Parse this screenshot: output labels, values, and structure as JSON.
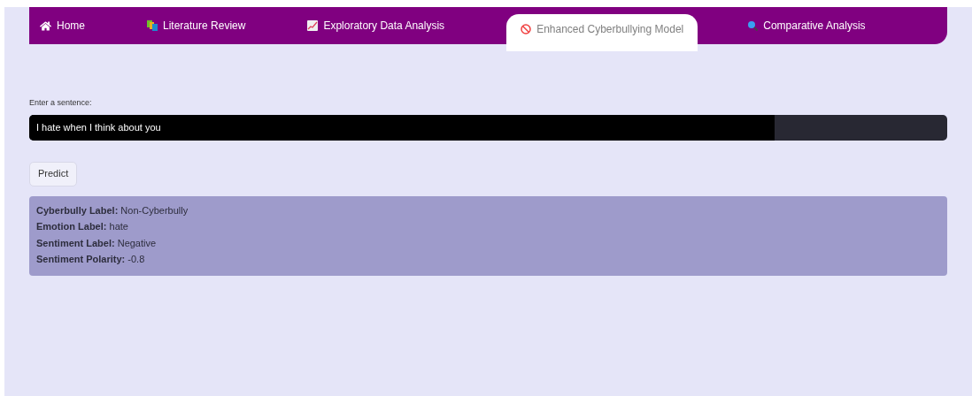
{
  "nav_tabs": [
    {
      "label": "Home",
      "kind": "home",
      "selected": false
    },
    {
      "label": "Literature Review",
      "kind": "books",
      "selected": false
    },
    {
      "label": "Exploratory Data Analysis",
      "kind": "chart",
      "selected": false
    },
    {
      "label": "Enhanced Cyberbullying Model",
      "kind": "prohibited",
      "selected": true
    },
    {
      "label": "Comparative Analysis",
      "kind": "search",
      "selected": false
    }
  ],
  "sentence_input": {
    "label": "Enter a sentence:",
    "value": "I hate when I think about you"
  },
  "predict_button": "Predict",
  "results": [
    {
      "label": "Cyberbully Label:",
      "value": "Non-Cyberbully"
    },
    {
      "label": "Emotion Label:",
      "value": "hate"
    },
    {
      "label": "Sentiment Label:",
      "value": "Negative"
    },
    {
      "label": "Sentiment Polarity:",
      "value": "-0.8"
    }
  ]
}
